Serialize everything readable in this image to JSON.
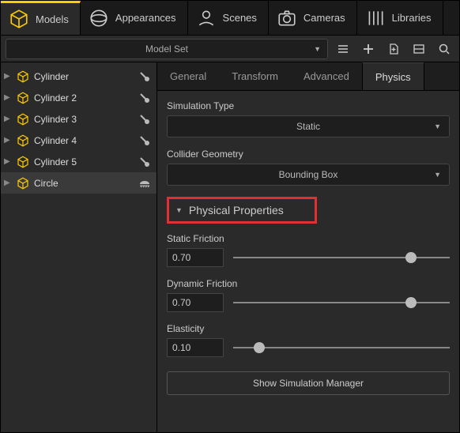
{
  "topTabs": {
    "models": "Models",
    "appearances": "Appearances",
    "scenes": "Scenes",
    "cameras": "Cameras",
    "libraries": "Libraries"
  },
  "toolbar": {
    "modelSetLabel": "Model Set"
  },
  "tree": {
    "items": [
      {
        "label": "Cylinder"
      },
      {
        "label": "Cylinder 2"
      },
      {
        "label": "Cylinder 3"
      },
      {
        "label": "Cylinder 4"
      },
      {
        "label": "Cylinder 5"
      },
      {
        "label": "Circle"
      }
    ]
  },
  "propTabs": {
    "general": "General",
    "transform": "Transform",
    "advanced": "Advanced",
    "physics": "Physics"
  },
  "physics": {
    "simTypeLabel": "Simulation Type",
    "simTypeValue": "Static",
    "colliderLabel": "Collider Geometry",
    "colliderValue": "Bounding Box",
    "sectionTitle": "Physical Properties",
    "staticFriction": {
      "label": "Static Friction",
      "value": "0.70",
      "pos": 82
    },
    "dynamicFriction": {
      "label": "Dynamic Friction",
      "value": "0.70",
      "pos": 82
    },
    "elasticity": {
      "label": "Elasticity",
      "value": "0.10",
      "pos": 12
    },
    "showManager": "Show Simulation Manager"
  }
}
